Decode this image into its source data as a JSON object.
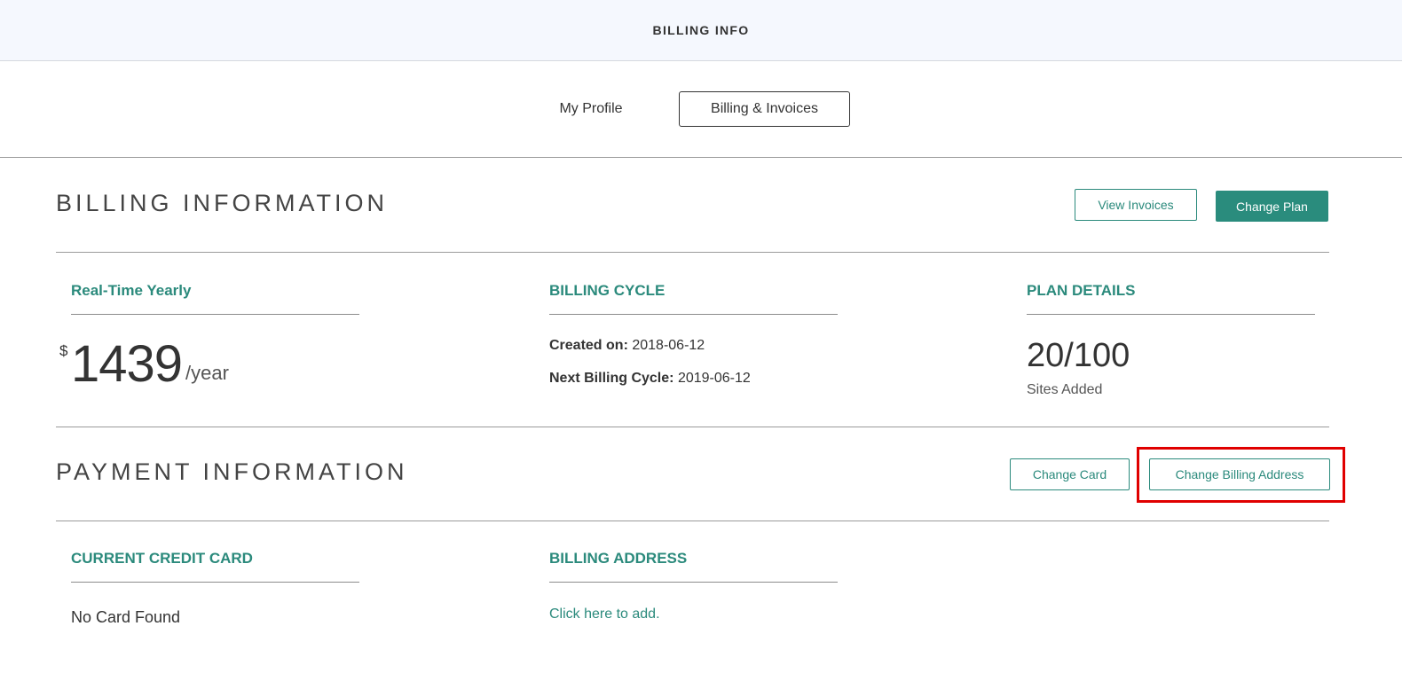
{
  "header": {
    "title": "BILLING INFO"
  },
  "tabs": [
    {
      "label": "My Profile",
      "active": false
    },
    {
      "label": "Billing & Invoices",
      "active": true
    }
  ],
  "billing": {
    "title": "BILLING INFORMATION",
    "view_invoices_label": "View Invoices",
    "change_plan_label": "Change Plan",
    "plan": {
      "heading": "Real-Time Yearly",
      "currency": "$",
      "amount": "1439",
      "unit": "/year"
    },
    "cycle": {
      "heading": "BILLING CYCLE",
      "created_label": "Created on:",
      "created_value": "2018-06-12",
      "next_label": "Next Billing Cycle:",
      "next_value": "2019-06-12"
    },
    "details": {
      "heading": "PLAN DETAILS",
      "sites_count": "20/100",
      "sites_label": "Sites Added"
    }
  },
  "payment": {
    "title": "PAYMENT INFORMATION",
    "change_card_label": "Change Card",
    "change_address_label": "Change Billing Address",
    "card": {
      "heading": "CURRENT CREDIT CARD",
      "value": "No Card Found"
    },
    "address": {
      "heading": "BILLING ADDRESS",
      "link": "Click here to add."
    }
  },
  "colors": {
    "accent": "#2b8a7c",
    "highlight": "#e00000"
  }
}
